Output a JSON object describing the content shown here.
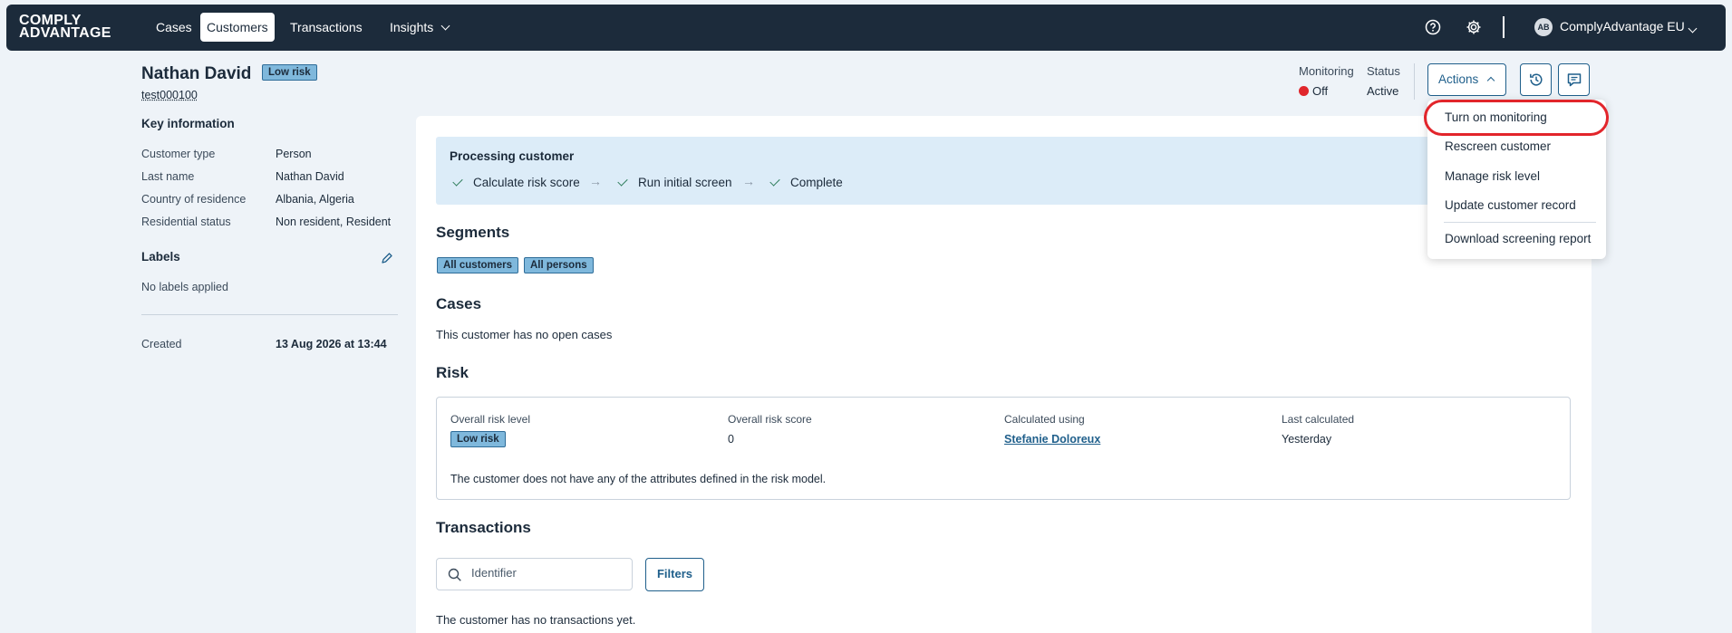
{
  "nav": {
    "logo_line1": "COMPLY",
    "logo_line2": "ADVANTAGE",
    "items": [
      "Cases",
      "Customers",
      "Transactions",
      "Insights"
    ],
    "active": "Customers",
    "account_initials": "AB",
    "account_name": "ComplyAdvantage EU"
  },
  "header": {
    "customer_name": "Nathan David",
    "risk_badge": "Low risk",
    "customer_id": "test000100",
    "monitoring_label": "Monitoring",
    "monitoring_value": "Off",
    "status_label": "Status",
    "status_value": "Active",
    "actions_label": "Actions"
  },
  "key_info": {
    "title": "Key information",
    "rows": [
      {
        "label": "Customer type",
        "value": "Person"
      },
      {
        "label": "Last name",
        "value": "Nathan David"
      },
      {
        "label": "Country of residence",
        "value": "Albania, Algeria"
      },
      {
        "label": "Residential status",
        "value": "Non resident, Resident"
      }
    ],
    "labels_title": "Labels",
    "labels_empty": "No labels applied",
    "created_label": "Created",
    "created_value": "13 Aug 2026 at 13:44"
  },
  "processing": {
    "title": "Processing customer",
    "steps": [
      "Calculate risk score",
      "Run initial screen",
      "Complete"
    ],
    "arrow": "→"
  },
  "segments": {
    "title": "Segments",
    "items": [
      "All customers",
      "All persons"
    ]
  },
  "cases": {
    "title": "Cases",
    "empty": "This customer has no open cases"
  },
  "risk": {
    "title": "Risk",
    "overall_level_label": "Overall risk level",
    "overall_level_value": "Low risk",
    "overall_score_label": "Overall risk score",
    "overall_score_value": "0",
    "calculated_using_label": "Calculated using",
    "calculated_using_value": "Stefanie Doloreux",
    "last_calculated_label": "Last calculated",
    "last_calculated_value": "Yesterday",
    "note": "The customer does not have any of the attributes defined in the risk model."
  },
  "transactions": {
    "title": "Transactions",
    "search_placeholder": "Identifier",
    "filters_label": "Filters",
    "empty": "The customer has no transactions yet."
  },
  "actions_menu": {
    "items": [
      "Turn on monitoring",
      "Rescreen customer",
      "Manage risk level",
      "Update customer record"
    ],
    "download": "Download screening report"
  },
  "colors": {
    "nav_bg": "#1c2b3b",
    "accent": "#1f5f8b",
    "monitoring_off": "#e0262c",
    "badge_bg": "#7fb8dc",
    "highlight": "#e2252b"
  }
}
